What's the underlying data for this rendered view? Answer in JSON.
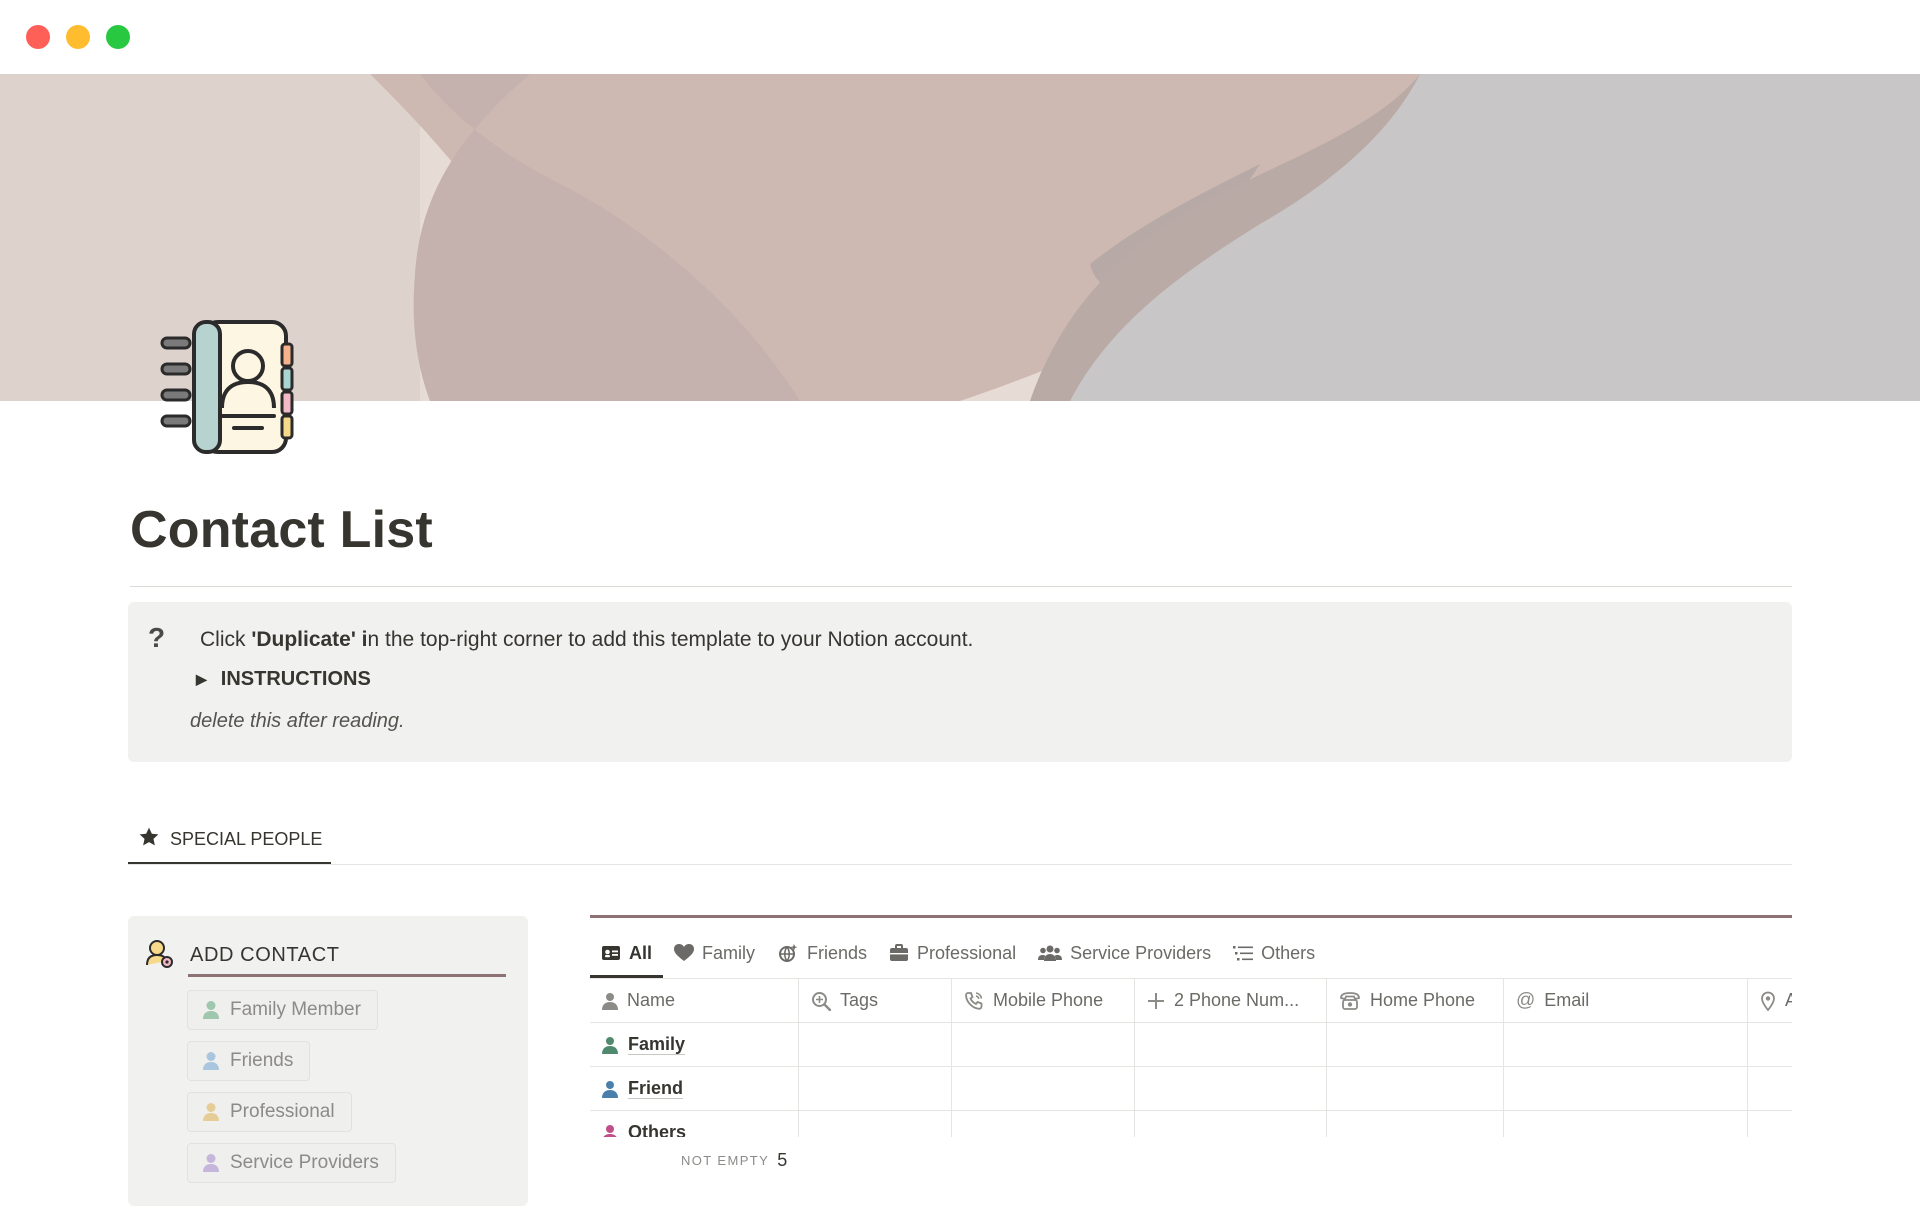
{
  "page": {
    "title": "Contact List"
  },
  "callout": {
    "text_prefix": "Click ",
    "text_bold": "'Duplicate' i",
    "text_suffix": "n the top-right corner to add this template to your Notion account.",
    "toggle_label": "INSTRUCTIONS",
    "note": "delete this after reading."
  },
  "section": {
    "tab_label": "SPECIAL PEOPLE"
  },
  "add_contact": {
    "title": "ADD  CONTACT",
    "buttons": [
      {
        "label": "Family Member",
        "color": "#4f8a6e"
      },
      {
        "label": "Friends",
        "color": "#6d9fc8"
      },
      {
        "label": "Professional",
        "color": "#d8b46a"
      },
      {
        "label": "Service Providers",
        "color": "#a48bc4"
      }
    ]
  },
  "database": {
    "views": [
      {
        "label": "All",
        "icon": "contact-card-icon",
        "active": true
      },
      {
        "label": "Family",
        "icon": "heart-icon",
        "active": false
      },
      {
        "label": "Friends",
        "icon": "friends-icon",
        "active": false
      },
      {
        "label": "Professional",
        "icon": "briefcase-icon",
        "active": false
      },
      {
        "label": "Service Providers",
        "icon": "people-group-icon",
        "active": false
      },
      {
        "label": "Others",
        "icon": "list-icon",
        "active": false
      }
    ],
    "columns": [
      {
        "label": "Name",
        "icon": "person-icon"
      },
      {
        "label": "Tags",
        "icon": "search-tag-icon"
      },
      {
        "label": "Mobile Phone",
        "icon": "phone-icon"
      },
      {
        "label": "2 Phone Num...",
        "icon": "plus-icon"
      },
      {
        "label": "Home Phone",
        "icon": "home-phone-icon"
      },
      {
        "label": "Email",
        "icon": "at-icon"
      },
      {
        "label": "A",
        "icon": "location-pin-icon"
      }
    ],
    "rows": [
      {
        "name": "Family",
        "color": "#4f8a6e"
      },
      {
        "name": "Friend",
        "color": "#4a7fab"
      },
      {
        "name": "Others",
        "color": "#c0508a"
      }
    ],
    "calculation": {
      "label": "NOT EMPTY",
      "value": "5"
    }
  }
}
